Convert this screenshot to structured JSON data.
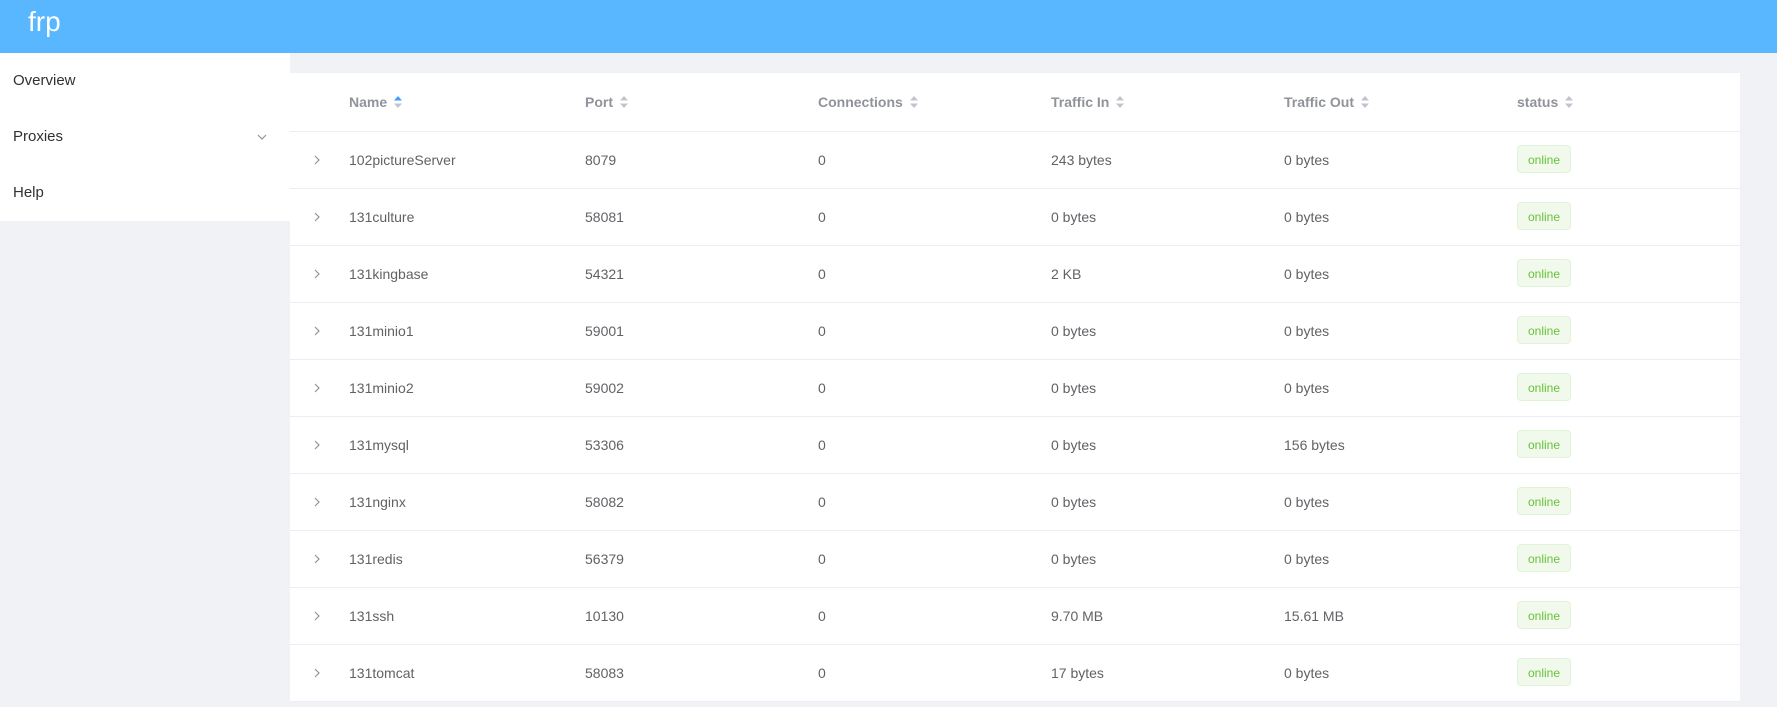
{
  "app": {
    "brand": "frp"
  },
  "sidebar": {
    "items": [
      {
        "label": "Overview"
      },
      {
        "label": "Proxies"
      },
      {
        "label": "Help"
      }
    ]
  },
  "table": {
    "columns": {
      "name": "Name",
      "port": "Port",
      "connections": "Connections",
      "traffic_in": "Traffic In",
      "traffic_out": "Traffic Out",
      "status": "status"
    },
    "sort": {
      "column": "name",
      "direction": "ascending"
    },
    "rows": [
      {
        "name": "102pictureServer",
        "port": "8079",
        "connections": "0",
        "traffic_in": "243 bytes",
        "traffic_out": "0 bytes",
        "status": "online"
      },
      {
        "name": "131culture",
        "port": "58081",
        "connections": "0",
        "traffic_in": "0 bytes",
        "traffic_out": "0 bytes",
        "status": "online"
      },
      {
        "name": "131kingbase",
        "port": "54321",
        "connections": "0",
        "traffic_in": "2 KB",
        "traffic_out": "0 bytes",
        "status": "online"
      },
      {
        "name": "131minio1",
        "port": "59001",
        "connections": "0",
        "traffic_in": "0 bytes",
        "traffic_out": "0 bytes",
        "status": "online"
      },
      {
        "name": "131minio2",
        "port": "59002",
        "connections": "0",
        "traffic_in": "0 bytes",
        "traffic_out": "0 bytes",
        "status": "online"
      },
      {
        "name": "131mysql",
        "port": "53306",
        "connections": "0",
        "traffic_in": "0 bytes",
        "traffic_out": "156 bytes",
        "status": "online"
      },
      {
        "name": "131nginx",
        "port": "58082",
        "connections": "0",
        "traffic_in": "0 bytes",
        "traffic_out": "0 bytes",
        "status": "online"
      },
      {
        "name": "131redis",
        "port": "56379",
        "connections": "0",
        "traffic_in": "0 bytes",
        "traffic_out": "0 bytes",
        "status": "online"
      },
      {
        "name": "131ssh",
        "port": "10130",
        "connections": "0",
        "traffic_in": "9.70 MB",
        "traffic_out": "15.61 MB",
        "status": "online"
      },
      {
        "name": "131tomcat",
        "port": "58083",
        "connections": "0",
        "traffic_in": "17 bytes",
        "traffic_out": "0 bytes",
        "status": "online"
      }
    ]
  },
  "colors": {
    "header": "#58b7ff",
    "sort_active": "#409eff",
    "online": "#67c23a"
  }
}
